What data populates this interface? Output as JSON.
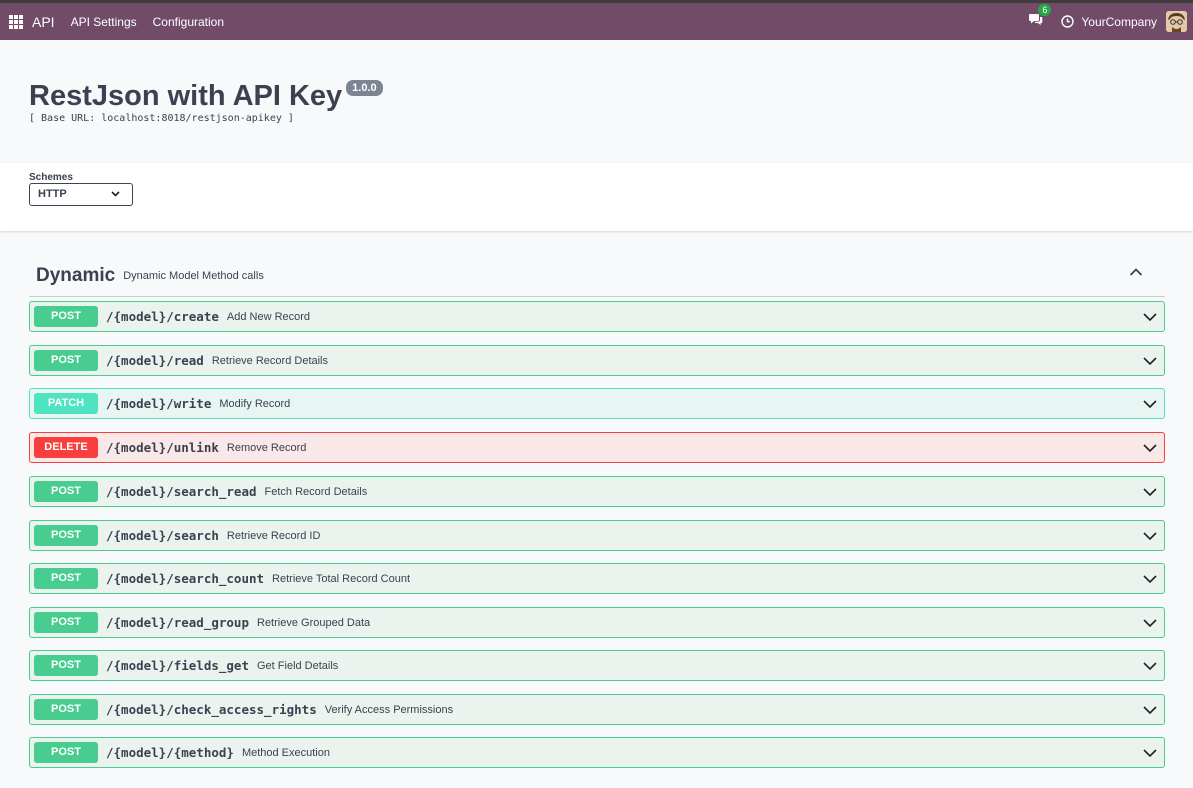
{
  "nav": {
    "brand": "API",
    "items": [
      "API Settings",
      "Configuration"
    ],
    "chat_count": "6",
    "company": "YourCompany"
  },
  "info": {
    "title": "RestJson with API Key",
    "version": "1.0.0",
    "base_url": "[ Base URL: localhost:8018/restjson-apikey ]"
  },
  "schemes": {
    "label": "Schemes",
    "selected": "HTTP"
  },
  "section": {
    "title": "Dynamic",
    "description": "Dynamic Model Method calls"
  },
  "operations": [
    {
      "method": "POST",
      "path": "/{model}/create",
      "summary": "Add New Record"
    },
    {
      "method": "POST",
      "path": "/{model}/read",
      "summary": "Retrieve Record Details"
    },
    {
      "method": "PATCH",
      "path": "/{model}/write",
      "summary": "Modify Record"
    },
    {
      "method": "DELETE",
      "path": "/{model}/unlink",
      "summary": "Remove Record"
    },
    {
      "method": "POST",
      "path": "/{model}/search_read",
      "summary": "Fetch Record Details"
    },
    {
      "method": "POST",
      "path": "/{model}/search",
      "summary": "Retrieve Record ID"
    },
    {
      "method": "POST",
      "path": "/{model}/search_count",
      "summary": "Retrieve Total Record Count"
    },
    {
      "method": "POST",
      "path": "/{model}/read_group",
      "summary": "Retrieve Grouped Data"
    },
    {
      "method": "POST",
      "path": "/{model}/fields_get",
      "summary": "Get Field Details"
    },
    {
      "method": "POST",
      "path": "/{model}/check_access_rights",
      "summary": "Verify Access Permissions"
    },
    {
      "method": "POST",
      "path": "/{model}/{method}",
      "summary": "Method Execution"
    }
  ],
  "colors": {
    "navbar": "#714b67",
    "post": "#49cc90",
    "patch": "#50e3c2",
    "delete": "#f93e3e"
  }
}
